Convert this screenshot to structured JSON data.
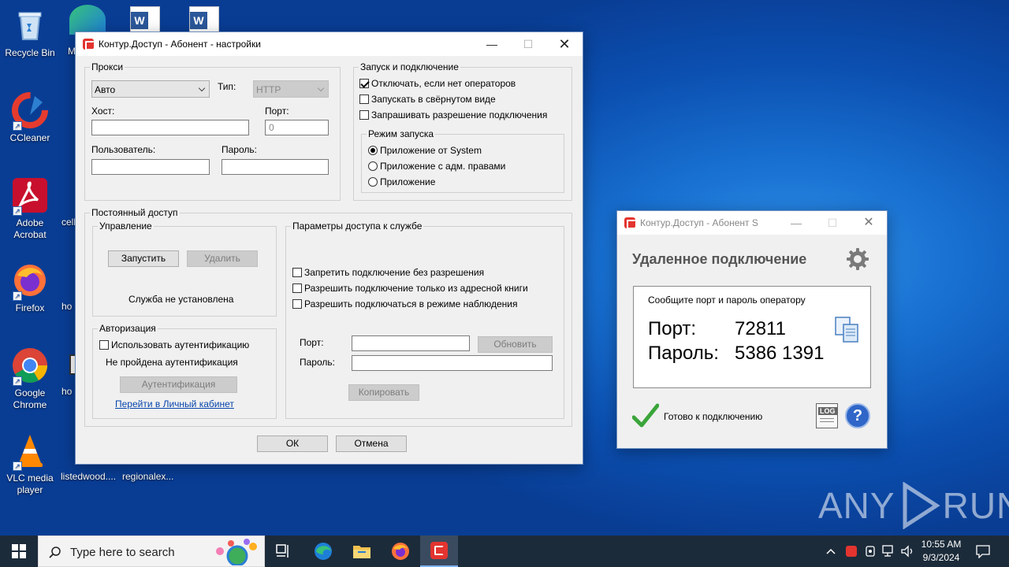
{
  "desktop": {
    "icons": [
      {
        "label": "Recycle Bin",
        "icon": "recycle-bin-icon"
      },
      {
        "label": "CCleaner",
        "icon": "ccleaner-icon"
      },
      {
        "label": "Adobe Acrobat",
        "icon": "acrobat-icon"
      },
      {
        "label": "Firefox",
        "icon": "firefox-icon"
      },
      {
        "label": "Google Chrome",
        "icon": "chrome-icon"
      },
      {
        "label": "VLC media player",
        "icon": "vlc-icon"
      }
    ],
    "partial_labels": {
      "m": "M",
      "cell": "cell",
      "ho1": "ho",
      "ho2": "ho",
      "listedwood": "listedwood....",
      "regionalex": "regionalex..."
    }
  },
  "settings_window": {
    "title": "Контур.Доступ - Абонент - настройки",
    "proxy": {
      "legend": "Прокси",
      "mode_value": "Авто",
      "type_label": "Тип:",
      "type_value": "HTTP",
      "host_label": "Хост:",
      "host_value": "",
      "port_label": "Порт:",
      "port_value": "0",
      "user_label": "Пользователь:",
      "user_value": "",
      "password_label": "Пароль:",
      "password_value": ""
    },
    "startup": {
      "legend": "Запуск и подключение",
      "disconnect_no_operators": "Отключать, если нет операторов",
      "start_minimized": "Запускать в свёрнутом виде",
      "ask_permission": "Запрашивать разрешение подключения",
      "mode_legend": "Режим запуска",
      "mode_system": "Приложение от System",
      "mode_admin": "Приложение с адм. правами",
      "mode_app": "Приложение"
    },
    "permanent": {
      "legend": "Постоянный доступ",
      "control_legend": "Управление",
      "start_button": "Запустить",
      "delete_button": "Удалить",
      "service_status": "Служба не установлена",
      "auth_legend": "Авторизация",
      "use_auth": "Использовать аутентификацию",
      "auth_status": "Не пройдена аутентификация",
      "auth_button": "Аутентификация",
      "cabinet_link": "Перейти в Личный кабинет",
      "params_legend": "Параметры доступа к службе",
      "deny_without_permission": "Запретить подключение без разрешения",
      "allow_address_book": "Разрешить подключение только из адресной книги",
      "allow_observe": "Разрешить подключаться в режиме наблюдения",
      "port_label": "Порт:",
      "port_value": "",
      "refresh_button": "Обновить",
      "password_label": "Пароль:",
      "password_value": "",
      "copy_button": "Копировать"
    },
    "ok_button": "ОК",
    "cancel_button": "Отмена"
  },
  "subscriber_window": {
    "title": "Контур.Доступ - Абонент S",
    "heading": "Удаленное подключение",
    "info_text": "Сообщите порт и пароль оператору",
    "port_label": "Порт:",
    "port_value": "72811",
    "password_label": "Пароль:",
    "password_value": "5386 1391",
    "status": "Готово к подключению",
    "log_label": "LOG"
  },
  "taskbar": {
    "search_placeholder": "Type here to search",
    "time": "10:55 AM",
    "date": "9/3/2024"
  },
  "watermark": {
    "text1": "ANY",
    "text2": "RUN"
  },
  "colors": {
    "accent_red": "#e3342f",
    "link": "#0645ad",
    "check_green": "#3aa53a"
  }
}
